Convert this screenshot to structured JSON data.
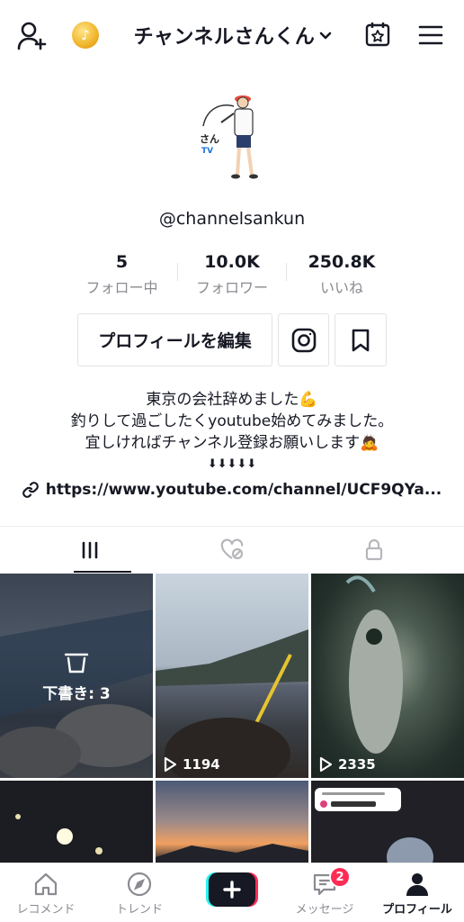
{
  "header": {
    "title": "チャンネルさんくん",
    "coin_symbol": "♪"
  },
  "profile": {
    "handle": "@channelsankun",
    "stats": [
      {
        "value": "5",
        "label": "フォロー中"
      },
      {
        "value": "10.0K",
        "label": "フォロワー"
      },
      {
        "value": "250.8K",
        "label": "いいね"
      }
    ],
    "edit_button": "プロフィールを編集",
    "bio": [
      "東京の会社辞めました💪",
      "釣りして過ごしたくyoutube始めてみました。",
      "宜しければチャンネル登録お願いします🙇",
      "⬇⬇⬇⬇⬇"
    ],
    "link": "https://www.youtube.com/channel/UCF9QYa..."
  },
  "videos": [
    {
      "type": "draft",
      "label": "下書き: 3"
    },
    {
      "type": "video",
      "views": "1194"
    },
    {
      "type": "video",
      "views": "2335"
    }
  ],
  "bottom_nav": {
    "home": "レコメンド",
    "trend": "トレンド",
    "messages": "メッセージ",
    "messages_badge": "2",
    "profile": "プロフィール"
  },
  "colors": {
    "accent": "#fe2c55",
    "cyan": "#25f4ee",
    "text": "#161823",
    "muted": "#8a8b91"
  }
}
